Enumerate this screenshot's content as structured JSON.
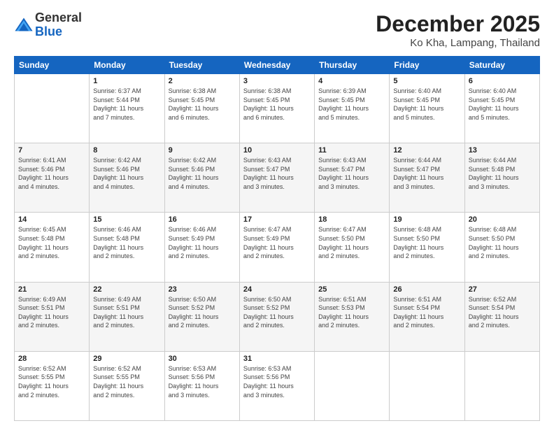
{
  "header": {
    "logo_general": "General",
    "logo_blue": "Blue",
    "month_title": "December 2025",
    "location": "Ko Kha, Lampang, Thailand"
  },
  "weekdays": [
    "Sunday",
    "Monday",
    "Tuesday",
    "Wednesday",
    "Thursday",
    "Friday",
    "Saturday"
  ],
  "weeks": [
    [
      {
        "day": null
      },
      {
        "day": "1",
        "sunrise": "6:37 AM",
        "sunset": "5:44 PM",
        "daylight": "11 hours and 7 minutes."
      },
      {
        "day": "2",
        "sunrise": "6:38 AM",
        "sunset": "5:45 PM",
        "daylight": "11 hours and 6 minutes."
      },
      {
        "day": "3",
        "sunrise": "6:38 AM",
        "sunset": "5:45 PM",
        "daylight": "11 hours and 6 minutes."
      },
      {
        "day": "4",
        "sunrise": "6:39 AM",
        "sunset": "5:45 PM",
        "daylight": "11 hours and 5 minutes."
      },
      {
        "day": "5",
        "sunrise": "6:40 AM",
        "sunset": "5:45 PM",
        "daylight": "11 hours and 5 minutes."
      },
      {
        "day": "6",
        "sunrise": "6:40 AM",
        "sunset": "5:45 PM",
        "daylight": "11 hours and 5 minutes."
      }
    ],
    [
      {
        "day": "7",
        "sunrise": "6:41 AM",
        "sunset": "5:46 PM",
        "daylight": "11 hours and 4 minutes."
      },
      {
        "day": "8",
        "sunrise": "6:42 AM",
        "sunset": "5:46 PM",
        "daylight": "11 hours and 4 minutes."
      },
      {
        "day": "9",
        "sunrise": "6:42 AM",
        "sunset": "5:46 PM",
        "daylight": "11 hours and 4 minutes."
      },
      {
        "day": "10",
        "sunrise": "6:43 AM",
        "sunset": "5:47 PM",
        "daylight": "11 hours and 3 minutes."
      },
      {
        "day": "11",
        "sunrise": "6:43 AM",
        "sunset": "5:47 PM",
        "daylight": "11 hours and 3 minutes."
      },
      {
        "day": "12",
        "sunrise": "6:44 AM",
        "sunset": "5:47 PM",
        "daylight": "11 hours and 3 minutes."
      },
      {
        "day": "13",
        "sunrise": "6:44 AM",
        "sunset": "5:48 PM",
        "daylight": "11 hours and 3 minutes."
      }
    ],
    [
      {
        "day": "14",
        "sunrise": "6:45 AM",
        "sunset": "5:48 PM",
        "daylight": "11 hours and 2 minutes."
      },
      {
        "day": "15",
        "sunrise": "6:46 AM",
        "sunset": "5:48 PM",
        "daylight": "11 hours and 2 minutes."
      },
      {
        "day": "16",
        "sunrise": "6:46 AM",
        "sunset": "5:49 PM",
        "daylight": "11 hours and 2 minutes."
      },
      {
        "day": "17",
        "sunrise": "6:47 AM",
        "sunset": "5:49 PM",
        "daylight": "11 hours and 2 minutes."
      },
      {
        "day": "18",
        "sunrise": "6:47 AM",
        "sunset": "5:50 PM",
        "daylight": "11 hours and 2 minutes."
      },
      {
        "day": "19",
        "sunrise": "6:48 AM",
        "sunset": "5:50 PM",
        "daylight": "11 hours and 2 minutes."
      },
      {
        "day": "20",
        "sunrise": "6:48 AM",
        "sunset": "5:50 PM",
        "daylight": "11 hours and 2 minutes."
      }
    ],
    [
      {
        "day": "21",
        "sunrise": "6:49 AM",
        "sunset": "5:51 PM",
        "daylight": "11 hours and 2 minutes."
      },
      {
        "day": "22",
        "sunrise": "6:49 AM",
        "sunset": "5:51 PM",
        "daylight": "11 hours and 2 minutes."
      },
      {
        "day": "23",
        "sunrise": "6:50 AM",
        "sunset": "5:52 PM",
        "daylight": "11 hours and 2 minutes."
      },
      {
        "day": "24",
        "sunrise": "6:50 AM",
        "sunset": "5:52 PM",
        "daylight": "11 hours and 2 minutes."
      },
      {
        "day": "25",
        "sunrise": "6:51 AM",
        "sunset": "5:53 PM",
        "daylight": "11 hours and 2 minutes."
      },
      {
        "day": "26",
        "sunrise": "6:51 AM",
        "sunset": "5:54 PM",
        "daylight": "11 hours and 2 minutes."
      },
      {
        "day": "27",
        "sunrise": "6:52 AM",
        "sunset": "5:54 PM",
        "daylight": "11 hours and 2 minutes."
      }
    ],
    [
      {
        "day": "28",
        "sunrise": "6:52 AM",
        "sunset": "5:55 PM",
        "daylight": "11 hours and 2 minutes."
      },
      {
        "day": "29",
        "sunrise": "6:52 AM",
        "sunset": "5:55 PM",
        "daylight": "11 hours and 2 minutes."
      },
      {
        "day": "30",
        "sunrise": "6:53 AM",
        "sunset": "5:56 PM",
        "daylight": "11 hours and 3 minutes."
      },
      {
        "day": "31",
        "sunrise": "6:53 AM",
        "sunset": "5:56 PM",
        "daylight": "11 hours and 3 minutes."
      },
      {
        "day": null
      },
      {
        "day": null
      },
      {
        "day": null
      }
    ]
  ],
  "labels": {
    "sunrise": "Sunrise:",
    "sunset": "Sunset:",
    "daylight": "Daylight:"
  }
}
